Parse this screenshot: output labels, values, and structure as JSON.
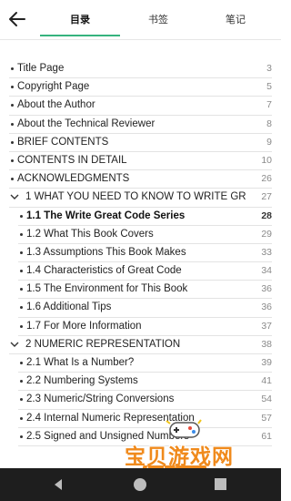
{
  "header": {
    "tabs": [
      {
        "label": "目录"
      },
      {
        "label": "书签"
      },
      {
        "label": "笔记"
      }
    ],
    "accent_color": "#36b37e"
  },
  "toc": [
    {
      "label": "Title Page",
      "page": "3",
      "level": 0
    },
    {
      "label": "Copyright Page",
      "page": "5",
      "level": 0
    },
    {
      "label": "About the Author",
      "page": "7",
      "level": 0
    },
    {
      "label": "About the Technical Reviewer",
      "page": "8",
      "level": 0
    },
    {
      "label": "BRIEF CONTENTS",
      "page": "9",
      "level": 0
    },
    {
      "label": "CONTENTS IN DETAIL",
      "page": "10",
      "level": 0
    },
    {
      "label": "ACKNOWLEDGMENTS",
      "page": "26",
      "level": 0
    },
    {
      "label": "1 WHAT YOU NEED TO KNOW TO WRITE GR...",
      "page": "27",
      "level": 0,
      "chapter": true
    },
    {
      "label": "1.1 The Write Great Code Series",
      "page": "28",
      "level": 1,
      "active": true
    },
    {
      "label": "1.2 What This Book Covers",
      "page": "29",
      "level": 1
    },
    {
      "label": "1.3 Assumptions This Book Makes",
      "page": "33",
      "level": 1
    },
    {
      "label": "1.4 Characteristics of Great Code",
      "page": "34",
      "level": 1
    },
    {
      "label": "1.5 The Environment for This Book",
      "page": "36",
      "level": 1
    },
    {
      "label": "1.6 Additional Tips",
      "page": "36",
      "level": 1
    },
    {
      "label": "1.7 For More Information",
      "page": "37",
      "level": 1
    },
    {
      "label": "2 NUMERIC REPRESENTATION",
      "page": "38",
      "level": 0,
      "chapter": true
    },
    {
      "label": "2.1 What Is a Number?",
      "page": "39",
      "level": 1
    },
    {
      "label": "2.2 Numbering Systems",
      "page": "41",
      "level": 1
    },
    {
      "label": "2.3 Numeric/String Conversions",
      "page": "54",
      "level": 1
    },
    {
      "label": "2.4 Internal Numeric Representation",
      "page": "57",
      "level": 1
    },
    {
      "label": "2.5 Signed and Unsigned Numbers",
      "page": "61",
      "level": 1
    }
  ],
  "watermark": {
    "title": "宝贝游戏网",
    "url": "baobeiy.com"
  }
}
